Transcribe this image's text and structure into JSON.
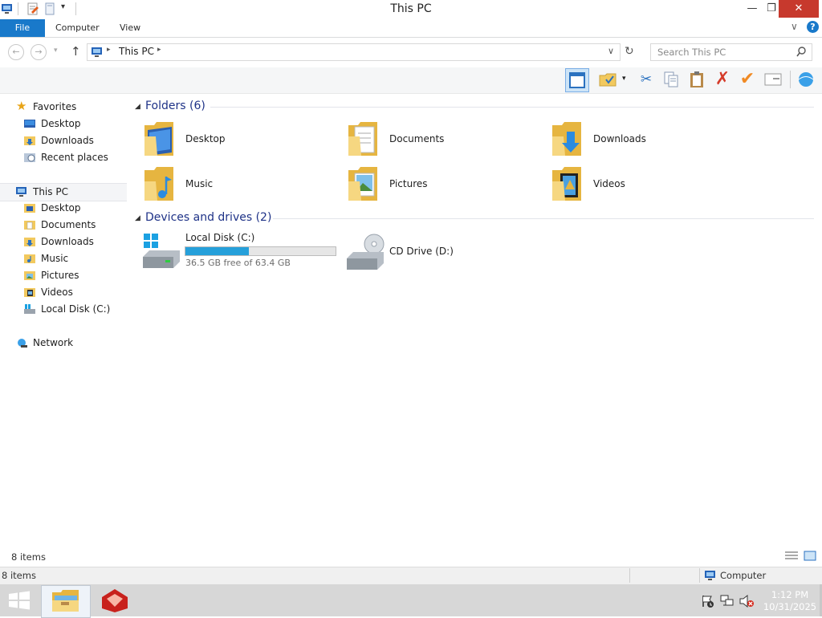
{
  "window": {
    "title": "This PC",
    "min_glyph": "—",
    "max_glyph": "❐",
    "close_glyph": "✕"
  },
  "ribbon": {
    "tabs": [
      "File",
      "Computer",
      "View"
    ],
    "expand_glyph": "∨",
    "help_glyph": "?"
  },
  "address": {
    "crumb": "This PC",
    "back_glyph": "←",
    "forward_glyph": "→",
    "up_glyph": "↑",
    "refresh_glyph": "↻",
    "search_placeholder": "Search This PC"
  },
  "nav": {
    "favorites": {
      "label": "Favorites",
      "items": [
        "Desktop",
        "Downloads",
        "Recent places"
      ]
    },
    "thispc": {
      "label": "This PC",
      "items": [
        "Desktop",
        "Documents",
        "Downloads",
        "Music",
        "Pictures",
        "Videos",
        "Local Disk (C:)"
      ]
    },
    "network": {
      "label": "Network"
    }
  },
  "folders": {
    "title": "Folders (6)",
    "items": [
      "Desktop",
      "Documents",
      "Downloads",
      "Music",
      "Pictures",
      "Videos"
    ]
  },
  "devices": {
    "title": "Devices and drives (2)",
    "drive_c": {
      "label": "Local Disk (C:)",
      "free_text": "36.5 GB free of 63.4 GB",
      "used_fraction": 0.42
    },
    "drive_d": {
      "label": "CD Drive (D:)"
    }
  },
  "status": {
    "item_count": "8 items",
    "bottom_count": "8 items",
    "location": "Computer"
  },
  "taskbar": {
    "time": "1:12 PM",
    "date": "10/31/2025"
  },
  "colors": {
    "accent": "#1979ca",
    "close": "#c7392d",
    "group_title": "#1e3287",
    "bar_fill": "#26a0da"
  }
}
